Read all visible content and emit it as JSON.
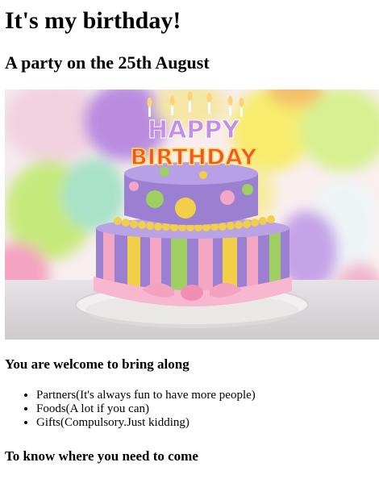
{
  "page": {
    "title": "It's my birthday!",
    "subtitle": "A party on the 25th August",
    "image": {
      "cake_topper_line1": "HAPPY",
      "cake_topper_line2": "BIRTHDAY"
    },
    "bring_heading": "You are welcome to bring along",
    "bring_items": [
      "Partners(It's always fun to have more people)",
      "Foods(A lot if you can)",
      "Gifts(Compulsory.Just kidding)"
    ],
    "location_heading": "To know where you need to come"
  },
  "colors": {
    "cake_purple": "#9b7fd0",
    "cake_pink": "#f3a7c4",
    "cake_yellow": "#f2cf49",
    "cake_green": "#9fcf62"
  }
}
